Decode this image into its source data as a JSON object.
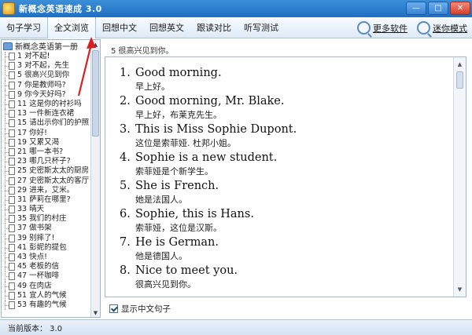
{
  "window": {
    "title": "新概念英语速成 3.0",
    "buttons": {
      "minimize": "—",
      "maximize": "□",
      "close": "✕"
    }
  },
  "toolbar": {
    "tabs": [
      {
        "label": "句子学习"
      },
      {
        "label": "全文浏览"
      },
      {
        "label": "回想中文"
      },
      {
        "label": "回想英文"
      },
      {
        "label": "跟读对比"
      },
      {
        "label": "听写测试"
      }
    ],
    "active_tab": "全文浏览",
    "more_software": "更多软件",
    "mini_mode": "迷你模式"
  },
  "tree": {
    "root": "新概念英语第一册",
    "items": [
      "1 对不起!",
      "3 对不起，先生",
      "5 很高兴见到你",
      "7 你是教师吗?",
      "9 你今天好吗?",
      "11 这是你的衬衫吗",
      "13 一件新连衣裙",
      "15 请出示你们的护照",
      "17 你好!",
      "19 又累又渴",
      "21 哪一本书?",
      "23 哪几只杯子?",
      "25 史密斯太太的厨房",
      "27 史密斯太太的客厅",
      "29 进来，艾米。",
      "31 萨莉在哪里?",
      "33 晴天",
      "35 我们的村庄",
      "37 做书架",
      "39 别摔了!",
      "41 彭妮的提包",
      "43 快点!",
      "45 老板的信",
      "47 一杯咖啡",
      "49 在肉店",
      "51 宜人的气候",
      "53 有趣的气候"
    ]
  },
  "lesson": {
    "header": "5 很高兴见到你。",
    "sentences": [
      {
        "num": "1.",
        "en": "Good morning.",
        "zh": "早上好。"
      },
      {
        "num": "2.",
        "en": "Good morning, Mr. Blake.",
        "zh": "早上好，布莱克先生。"
      },
      {
        "num": "3.",
        "en": "This is Miss Sophie Dupont.",
        "zh": "这位是索菲娅. 杜邦小姐。"
      },
      {
        "num": "4.",
        "en": "Sophie is a new student.",
        "zh": "索菲娅是个新学生。"
      },
      {
        "num": "5.",
        "en": "She is French.",
        "zh": "她是法国人。"
      },
      {
        "num": "6.",
        "en": "Sophie, this is Hans.",
        "zh": "索菲娅，这位是汉斯。"
      },
      {
        "num": "7.",
        "en": "He is German.",
        "zh": "他是德国人。"
      },
      {
        "num": "8.",
        "en": "Nice to meet you.",
        "zh": "很高兴见到你。"
      }
    ],
    "show_chinese_label": "显示中文句子",
    "show_chinese_checked": true
  },
  "status": {
    "text": "当前版本： 3.0"
  },
  "colors": {
    "titlebar": "#2a7bd0",
    "annotation": "#d82020"
  }
}
